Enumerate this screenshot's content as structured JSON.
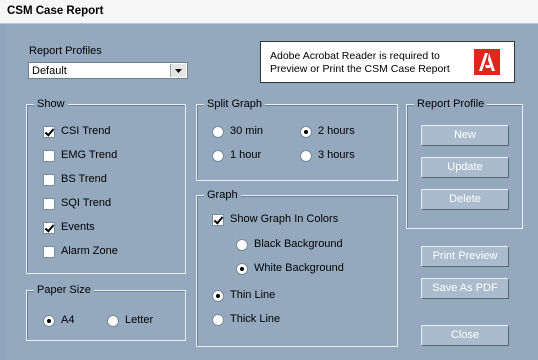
{
  "window": {
    "title": "CSM Case Report"
  },
  "report_profiles": {
    "label": "Report Profiles",
    "selected": "Default"
  },
  "acrobat_notice": {
    "line1": "Adobe Acrobat Reader is required to",
    "line2": "Preview or Print the CSM Case Report"
  },
  "show": {
    "legend": "Show",
    "items": [
      {
        "label": "CSI Trend",
        "checked": true
      },
      {
        "label": "EMG Trend",
        "checked": false
      },
      {
        "label": "BS Trend",
        "checked": false
      },
      {
        "label": "SQI Trend",
        "checked": false
      },
      {
        "label": "Events",
        "checked": true
      },
      {
        "label": "Alarm Zone",
        "checked": false
      }
    ]
  },
  "split_graph": {
    "legend": "Split Graph",
    "options": [
      {
        "label": "30 min",
        "selected": false
      },
      {
        "label": "2 hours",
        "selected": true
      },
      {
        "label": "1 hour",
        "selected": false
      },
      {
        "label": "3 hours",
        "selected": false
      }
    ]
  },
  "graph": {
    "legend": "Graph",
    "show_colors_label": "Show Graph In Colors",
    "show_colors_checked": true,
    "background_options": [
      {
        "label": "Black Background",
        "selected": false
      },
      {
        "label": "White Background",
        "selected": true
      }
    ],
    "line_options": [
      {
        "label": "Thin Line",
        "selected": true
      },
      {
        "label": "Thick Line",
        "selected": false
      }
    ]
  },
  "report_profile": {
    "legend": "Report Profile",
    "new_label": "New",
    "update_label": "Update",
    "delete_label": "Delete"
  },
  "paper_size": {
    "legend": "Paper Size",
    "options": [
      {
        "label": "A4",
        "selected": true
      },
      {
        "label": "Letter",
        "selected": false
      }
    ]
  },
  "actions": {
    "print_preview_label": "Print Preview",
    "save_pdf_label": "Save As PDF",
    "close_label": "Close"
  },
  "colors": {
    "background": "#94a9be",
    "button": "#a9bbcd",
    "acrobat_red": "#e2261c"
  }
}
